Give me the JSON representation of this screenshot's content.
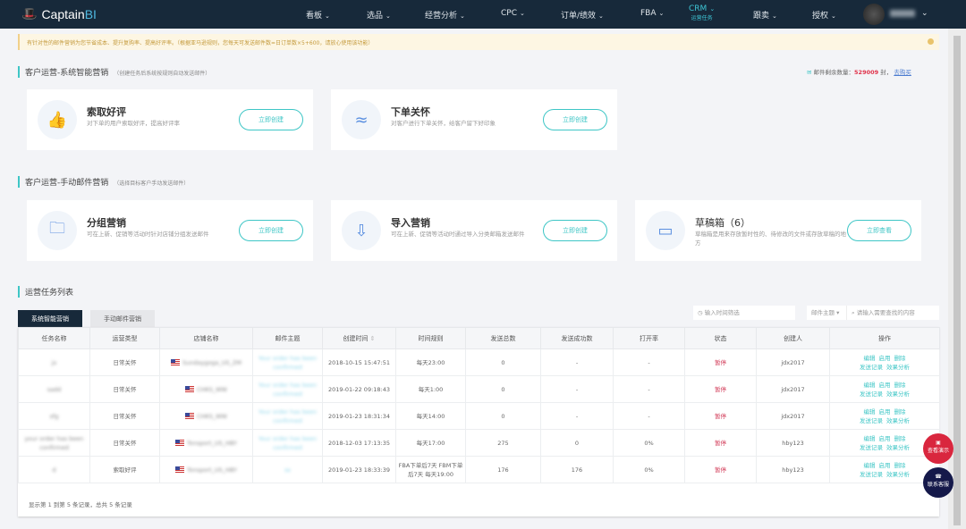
{
  "nav": {
    "logo": "Captain",
    "logo_accent": "BI",
    "items": [
      "看板",
      "选品",
      "经营分析",
      "CPC",
      "订单/绩效",
      "FBA",
      "CRM",
      "跟卖",
      "授权"
    ],
    "active_sub": "运营任务",
    "user": "jdx2017"
  },
  "notice": "有针对性的邮件营销为您节省成本、提升复购率、提高好评率。（根据亚马逊规则，您每天可发送邮件数=日订单数×5+600，请放心使用该功能）",
  "section1": {
    "title": "客户运营-系统智能营销",
    "hint": "（创建任务后系统按规则自动发送邮件）"
  },
  "quota": {
    "label": "邮件剩余数量：",
    "value": "529009",
    "unit": "封，",
    "link": "去购买"
  },
  "auto_cards": [
    {
      "title": "索取好评",
      "desc": "对下单的用户索取好评，提高好评率",
      "button": "立即创建",
      "icon": "thumbs-up-icon"
    },
    {
      "title": "下单关怀",
      "desc": "对客户进行下单关怀，给客户留下好印象",
      "button": "立即创建",
      "icon": "care-hands-icon"
    }
  ],
  "section2": {
    "title": "客户运营-手动邮件营销",
    "hint": "（选择目标客户手动发送邮件）"
  },
  "manual_cards": [
    {
      "title": "分组营销",
      "desc": "可在上新、促销等活动时针对店铺分组发送邮件",
      "button": "立即创建",
      "icon": "folder-group-icon"
    },
    {
      "title": "导入营销",
      "desc": "可在上新、促销等活动时通过导入分类邮箱发送邮件",
      "button": "立即创建",
      "icon": "import-icon"
    },
    {
      "title": "草稿箱（6）",
      "desc": "草稿箱是用来存放暂时性的、待修改的文件或存放草稿的地方",
      "button": "立即查看",
      "icon": "draft-box-icon"
    }
  ],
  "section3": {
    "title": "运营任务列表"
  },
  "tabs": [
    "系统智能营销",
    "手动邮件营销"
  ],
  "filters": {
    "time_placeholder": "输入时间筛选",
    "field_select": "邮件主题",
    "search_placeholder": "请输入需要查找的内容"
  },
  "table": {
    "headers": [
      "任务名称",
      "运营类型",
      "店铺名称",
      "邮件主题",
      "创建时间",
      "时间规则",
      "发送总数",
      "发送成功数",
      "打开率",
      "状态",
      "创建人",
      "操作"
    ],
    "rows": [
      {
        "name": "jx",
        "type": "日常关怀",
        "store": "Sundaygoga_US_ZM",
        "subject": "Your order has been confirmed",
        "created": "2018-10-15 15:47:51",
        "rule": "每天23:00",
        "total": "0",
        "success": "-",
        "open": "-",
        "status": "暂停",
        "creator": "jdx2017"
      },
      {
        "name": "sadd",
        "type": "日常关怀",
        "store": "CHKS_WW",
        "subject": "Your order has been confirmed",
        "created": "2019-01-22 09:18:43",
        "rule": "每天1:00",
        "total": "0",
        "success": "-",
        "open": "-",
        "status": "暂停",
        "creator": "jdx2017"
      },
      {
        "name": "sfg",
        "type": "日常关怀",
        "store": "CHKS_WW",
        "subject": "Your order has been confirmed",
        "created": "2019-01-23 18:31:34",
        "rule": "每天14:00",
        "total": "0",
        "success": "-",
        "open": "-",
        "status": "暂停",
        "creator": "jdx2017"
      },
      {
        "name": "your order has been confirmed",
        "type": "日常关怀",
        "store": "Tonsport_US_HBY",
        "subject": "Your order has been confirmed",
        "created": "2018-12-03 17:13:35",
        "rule": "每天17:00",
        "total": "275",
        "success": "0",
        "open": "0%",
        "status": "暂停",
        "creator": "hby123"
      },
      {
        "name": "d",
        "type": "索取好评",
        "store": "Tonsport_US_HBY",
        "subject": "ss",
        "created": "2019-01-23 18:33:39",
        "rule": "FBA下单后7天 FBM下单后7天 每天19:00",
        "total": "176",
        "success": "176",
        "open": "0%",
        "status": "暂停",
        "creator": "hby123"
      }
    ],
    "ops": [
      "编辑",
      "启用",
      "删除",
      "发送记录",
      "效果分析"
    ],
    "footer": "显示第 1 到第 5 条记录，总共 5 条记录"
  },
  "floating": [
    "查看演示",
    "联系客服"
  ]
}
